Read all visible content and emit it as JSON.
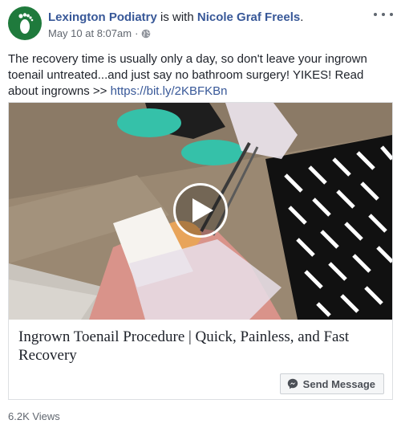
{
  "post": {
    "page_name": "Lexington Podiatry",
    "with_text": " is with ",
    "tagged_person": "Nicole Graf Freels",
    "period": ".",
    "timestamp": "May 10 at 8:07am",
    "separator": "·",
    "privacy_icon": "globe-icon",
    "avatar_icon": "footprint-logo",
    "more_icon": "more-options-icon",
    "text_before_link": "The recovery time is usually only a day, so don't leave your ingrown toenail untreated...and just say no bathroom surgery! YIKES! Read about ingrowns >> ",
    "link_text": "https://bit.ly/2KBFKBn"
  },
  "attachment": {
    "play_icon": "play-icon",
    "title": "Ingrown Toenail Procedure | Quick, Painless, and Fast Recovery",
    "cta_label": "Send Message",
    "cta_icon": "messenger-icon"
  },
  "footer": {
    "views": "6.2K Views"
  },
  "colors": {
    "link": "#385898",
    "brand_green": "#1f7a3c",
    "meta_gray": "#616770"
  }
}
